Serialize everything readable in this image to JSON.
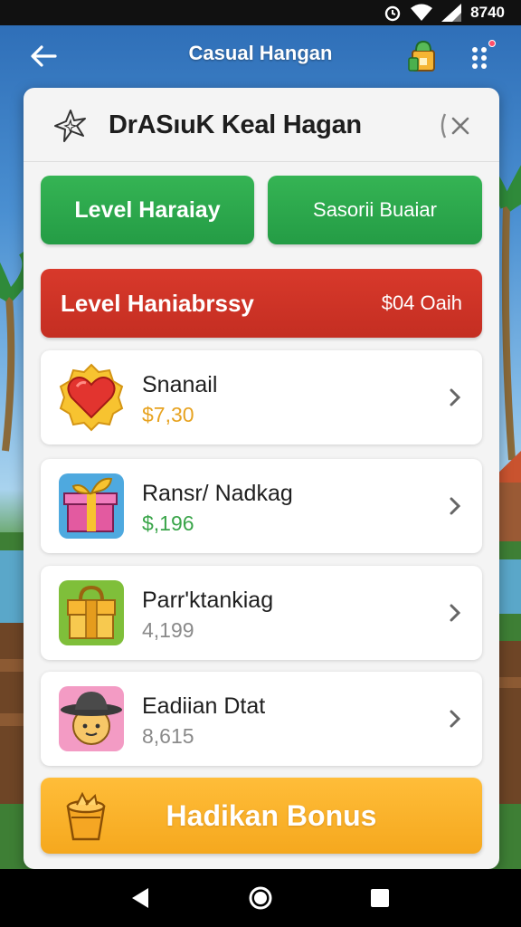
{
  "status_bar": {
    "time": "8740",
    "icons": [
      "alarm-icon",
      "wifi-icon",
      "signal-icon"
    ]
  },
  "app_bar": {
    "title": "Casual Hangan",
    "back_icon": "arrow-left-icon",
    "shop_icon": "shop-icon",
    "menu_icon": "dots-menu-icon"
  },
  "dialog": {
    "title": "DrASıuK Keal Hagan",
    "header_icon": "sparkle-star-icon",
    "close_icon": "close-icon",
    "buttons": [
      {
        "label": "Level Haraiay"
      },
      {
        "label": "Sasorii Buaiar"
      }
    ],
    "level_banner": {
      "title": "Level Haniabrssy",
      "value": "$04 Oaih"
    },
    "items": [
      {
        "name": "Snanail",
        "value": "$7,30",
        "value_color": "#e7a321",
        "icon": "heart-badge-icon"
      },
      {
        "name": "Ransr/ Nadkag",
        "value": "$,196",
        "value_color": "#3aa54a",
        "icon": "gift-box-icon"
      },
      {
        "name": "Parr'ktankiag",
        "value": "4,199",
        "value_color": "#8a8a8a",
        "icon": "chest-icon"
      },
      {
        "name": "Eadiian Dtat",
        "value": "8,615",
        "value_color": "#8a8a8a",
        "icon": "character-hat-icon"
      }
    ],
    "bonus_button": {
      "label": "Hadikan Bonus",
      "icon": "bucket-icon"
    }
  },
  "nav_bar": {
    "back_icon": "nav-back-icon",
    "home_icon": "nav-home-icon",
    "recents_icon": "nav-recents-icon"
  },
  "colors": {
    "green_button": "#2aa64b",
    "red_banner": "#cc3326",
    "orange_button": "#f7ad25",
    "card_bg": "#f4f4f4"
  }
}
